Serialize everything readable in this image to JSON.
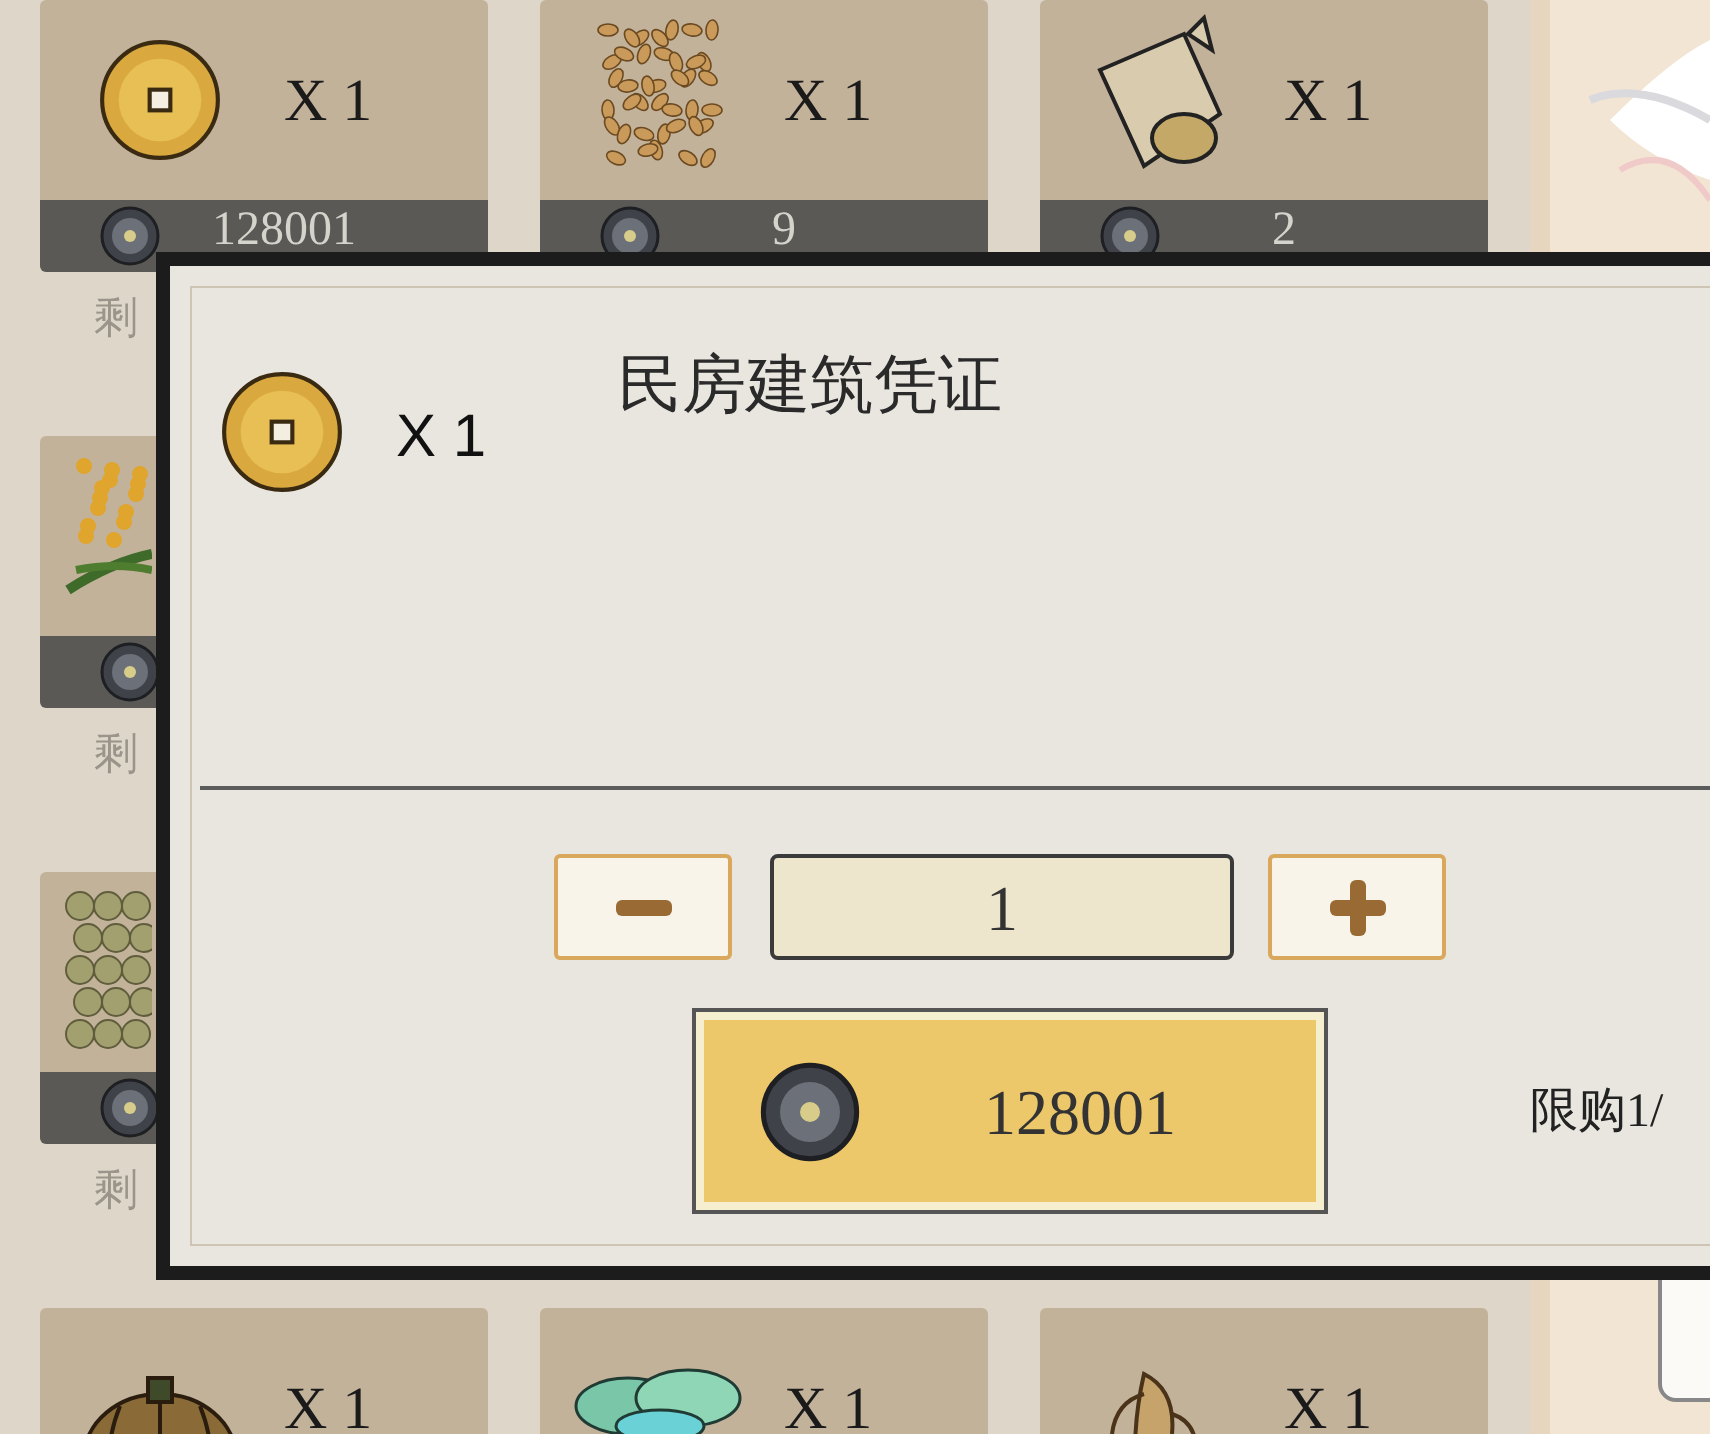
{
  "shop_rows": [
    {
      "items": [
        {
          "kind": "coin",
          "quantity": "X 1",
          "price": "128001",
          "remaining": "剩"
        },
        {
          "kind": "grain",
          "quantity": "X 1",
          "price": "9"
        },
        {
          "kind": "log",
          "quantity": "X 1",
          "price": "2"
        }
      ]
    },
    {
      "items": [
        {
          "kind": "millet",
          "remaining": "剩"
        }
      ]
    },
    {
      "items": [
        {
          "kind": "beans",
          "remaining": "剩"
        }
      ]
    },
    {
      "items": [
        {
          "kind": "pumpkin",
          "quantity": "X 1"
        },
        {
          "kind": "jade",
          "quantity": "X 1"
        },
        {
          "kind": "ginseng",
          "quantity": "X 1"
        }
      ]
    }
  ],
  "dialog": {
    "item_quantity": "X 1",
    "title": "民房建筑凭证",
    "quantity_value": "1",
    "buy_price": "128001",
    "limit": "限购1/"
  }
}
